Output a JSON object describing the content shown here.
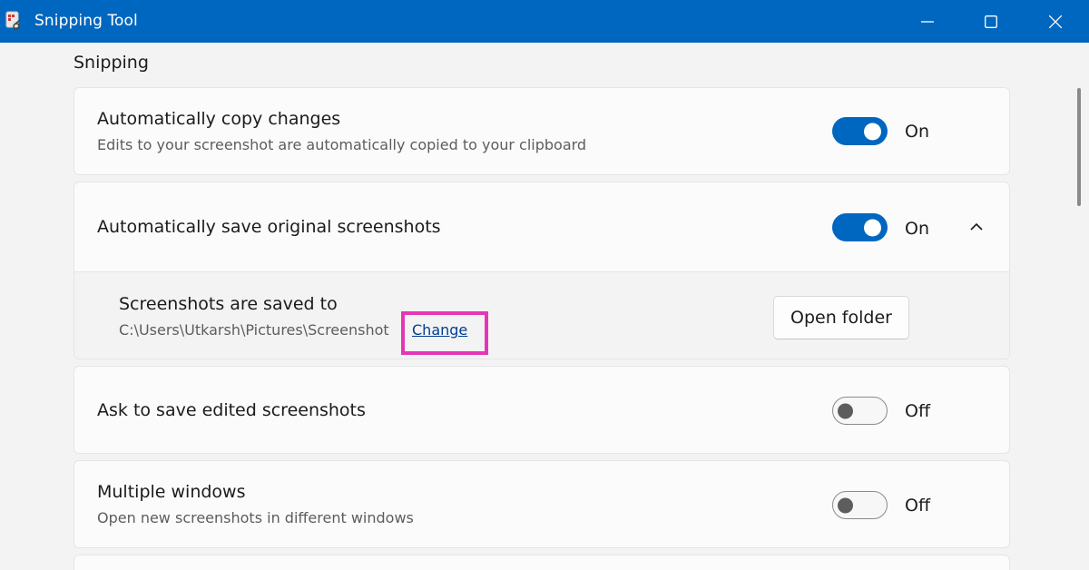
{
  "window": {
    "title": "Snipping Tool",
    "accent": "#0067c0",
    "controls": {
      "minimize": "minimize-icon",
      "maximize": "maximize-icon",
      "close": "close-icon"
    }
  },
  "section": {
    "title": "Snipping"
  },
  "settings": {
    "copy": {
      "title": "Automatically copy changes",
      "description": "Edits to your screenshot are automatically copied to your clipboard",
      "state": "On"
    },
    "save": {
      "title": "Automatically save original screenshots",
      "state": "On",
      "expanded": true,
      "location_title": "Screenshots are saved to",
      "location_path": "C:\\Users\\Utkarsh\\Pictures\\Screenshot",
      "change_label": "Change",
      "open_folder_label": "Open folder"
    },
    "ask": {
      "title": "Ask to save edited screenshots",
      "state": "Off"
    },
    "multi": {
      "title": "Multiple windows",
      "description": "Open new screenshots in different windows",
      "state": "Off"
    }
  },
  "highlight_color": "#e535b8"
}
